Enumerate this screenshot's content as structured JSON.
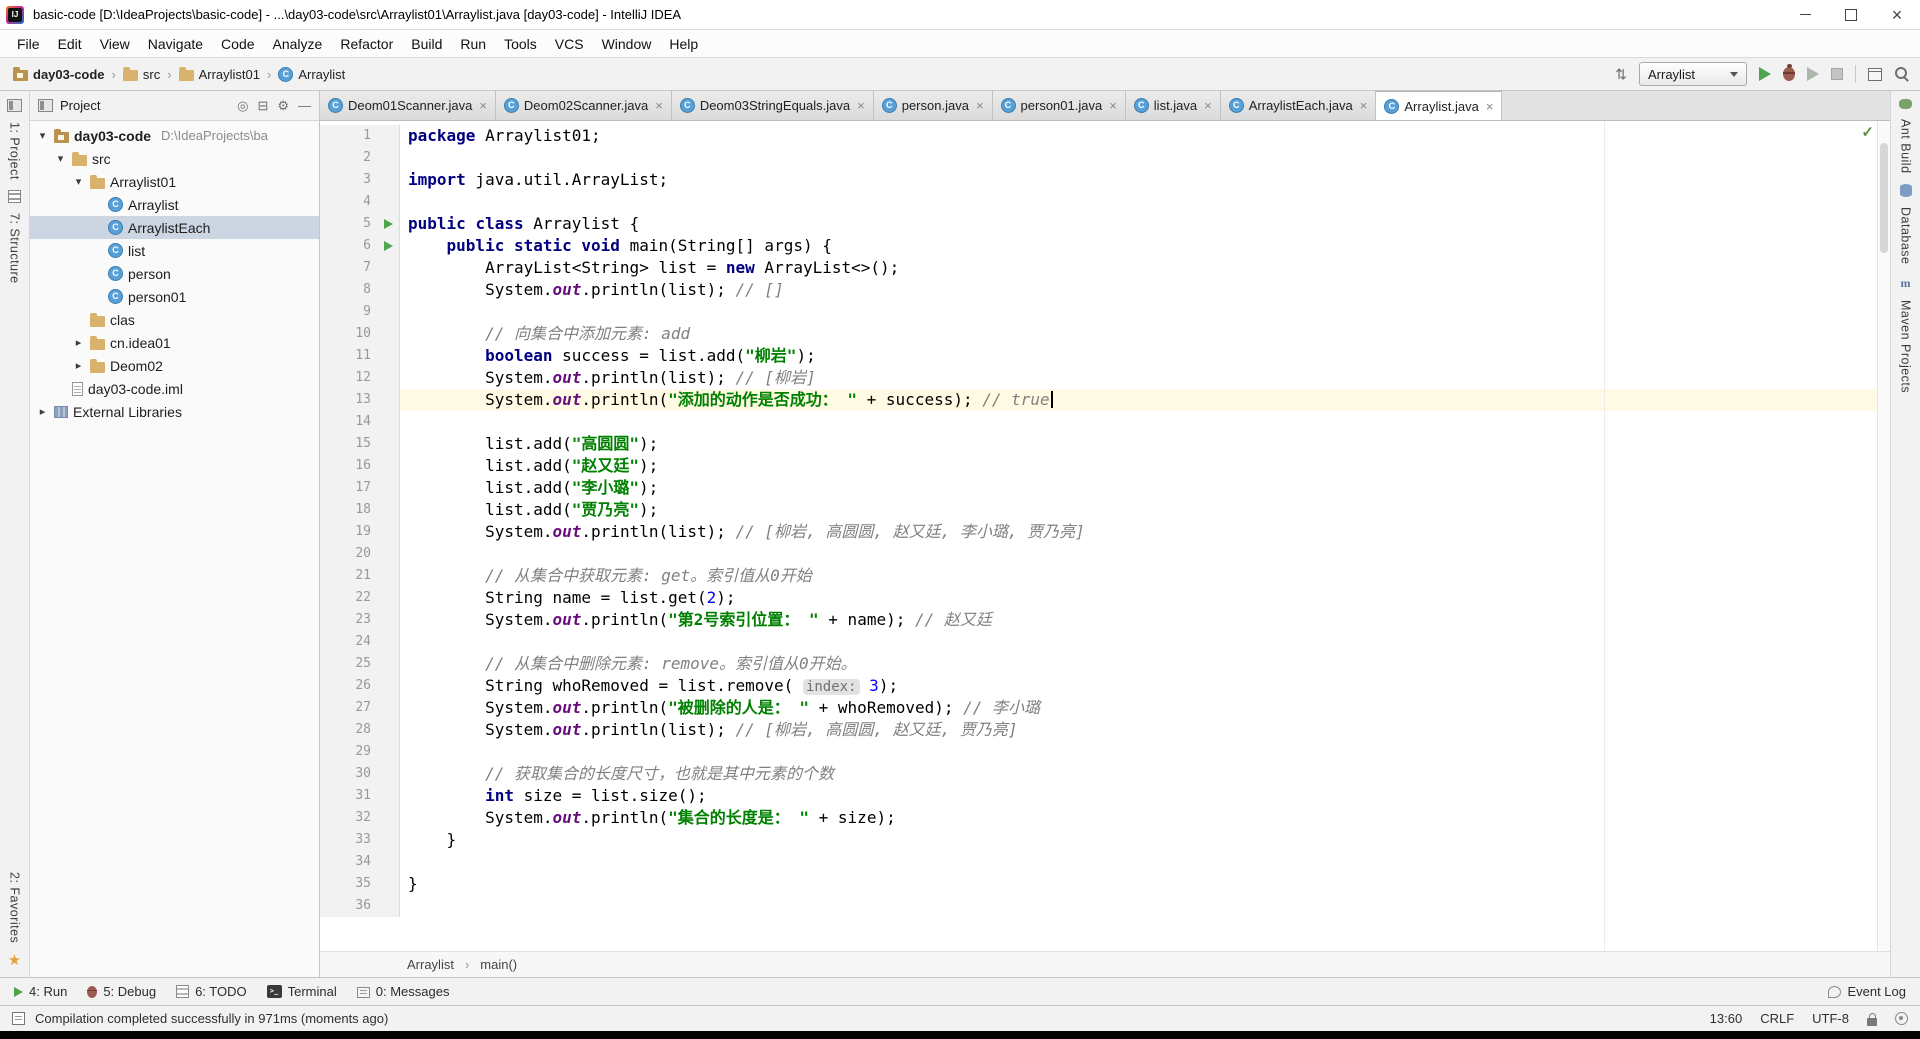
{
  "window": {
    "title": "basic-code [D:\\IdeaProjects\\basic-code] - ...\\day03-code\\src\\Arraylist01\\Arraylist.java [day03-code] - IntelliJ IDEA"
  },
  "menu": [
    "File",
    "Edit",
    "View",
    "Navigate",
    "Code",
    "Analyze",
    "Refactor",
    "Build",
    "Run",
    "Tools",
    "VCS",
    "Window",
    "Help"
  ],
  "navbar": {
    "crumbs": [
      {
        "label": "day03-code",
        "icon": "project"
      },
      {
        "label": "src",
        "icon": "folder"
      },
      {
        "label": "Arraylist01",
        "icon": "folder"
      },
      {
        "label": "Arraylist",
        "icon": "class"
      }
    ],
    "pre_icons": [
      "updates"
    ],
    "run_config": "Arraylist",
    "post_icons": [
      "run",
      "debug",
      "coverage",
      "stop",
      "sep",
      "project-structure",
      "search-everywhere"
    ]
  },
  "left_stripe": {
    "top": [
      {
        "icon": "tool-project",
        "label": "1: Project"
      },
      {
        "icon": "tool-structure",
        "label": "7: Structure"
      }
    ],
    "bottom": [
      {
        "label": "2: Favorites",
        "icon": "favorites-star",
        "icon_after": true
      }
    ]
  },
  "right_stripe": [
    {
      "icon": "tool-ant",
      "label": "Ant Build"
    },
    {
      "icon": "tool-db",
      "label": "Database"
    },
    {
      "icon": "tool-maven",
      "label": "Maven Projects"
    }
  ],
  "project_panel": {
    "title": "Project",
    "header_icons": [
      "locate",
      "collapse-all",
      "settings-gear",
      "hide-panel"
    ],
    "tree": [
      {
        "label": "day03-code",
        "hint": "D:\\IdeaProjects\\ba",
        "icon": "project",
        "depth": 0,
        "expand": "open",
        "bold": true
      },
      {
        "label": "src",
        "icon": "folder",
        "depth": 1,
        "expand": "open"
      },
      {
        "label": "Arraylist01",
        "icon": "folder",
        "depth": 2,
        "expand": "open"
      },
      {
        "label": "Arraylist",
        "icon": "class",
        "depth": 3
      },
      {
        "label": "ArraylistEach",
        "icon": "class",
        "depth": 3,
        "selected": true
      },
      {
        "label": "list",
        "icon": "class",
        "depth": 3
      },
      {
        "label": "person",
        "icon": "class",
        "depth": 3
      },
      {
        "label": "person01",
        "icon": "class",
        "depth": 3
      },
      {
        "label": "clas",
        "icon": "folder",
        "depth": 2
      },
      {
        "label": "cn.idea01",
        "icon": "folder",
        "depth": 2,
        "expand": "closed"
      },
      {
        "label": "Deom02",
        "icon": "folder",
        "depth": 2,
        "expand": "closed"
      },
      {
        "label": "day03-code.iml",
        "icon": "file",
        "depth": 1
      },
      {
        "label": "External Libraries",
        "icon": "lib",
        "depth": 0,
        "expand": "closed"
      }
    ]
  },
  "tabs": [
    {
      "label": "Deom01Scanner.java"
    },
    {
      "label": "Deom02Scanner.java"
    },
    {
      "label": "Deom03StringEquals.java"
    },
    {
      "label": "person.java"
    },
    {
      "label": "person01.java"
    },
    {
      "label": "list.java"
    },
    {
      "label": "ArraylistEach.java"
    },
    {
      "label": "Arraylist.java",
      "active": true
    }
  ],
  "editor": {
    "current_line": 13,
    "breadcrumb": [
      "Arraylist",
      "main()"
    ],
    "lines": [
      {
        "n": 1,
        "t": [
          [
            "k",
            "package"
          ],
          [
            "p",
            " Arraylist01;"
          ]
        ]
      },
      {
        "n": 2,
        "t": []
      },
      {
        "n": 3,
        "t": [
          [
            "k",
            "import"
          ],
          [
            "p",
            " java.util.ArrayList;"
          ]
        ]
      },
      {
        "n": 4,
        "t": []
      },
      {
        "n": 5,
        "run": true,
        "t": [
          [
            "k",
            "public"
          ],
          [
            "p",
            " "
          ],
          [
            "k",
            "class"
          ],
          [
            "p",
            " Arraylist {"
          ]
        ]
      },
      {
        "n": 6,
        "run": true,
        "t": [
          [
            "p",
            "    "
          ],
          [
            "k",
            "public"
          ],
          [
            "p",
            " "
          ],
          [
            "k",
            "static"
          ],
          [
            "p",
            " "
          ],
          [
            "k",
            "void"
          ],
          [
            "p",
            " main(String[] args) {"
          ]
        ]
      },
      {
        "n": 7,
        "t": [
          [
            "p",
            "        ArrayList<String> list = "
          ],
          [
            "k",
            "new"
          ],
          [
            "p",
            " ArrayList<>();"
          ]
        ]
      },
      {
        "n": 8,
        "t": [
          [
            "p",
            "        System."
          ],
          [
            "f",
            "out"
          ],
          [
            "p",
            ".println(list); "
          ],
          [
            "c",
            "// []"
          ]
        ]
      },
      {
        "n": 9,
        "t": []
      },
      {
        "n": 10,
        "t": [
          [
            "p",
            "        "
          ],
          [
            "c",
            "// 向集合中添加元素: add"
          ]
        ]
      },
      {
        "n": 11,
        "t": [
          [
            "p",
            "        "
          ],
          [
            "k",
            "boolean"
          ],
          [
            "p",
            " success = list.add("
          ],
          [
            "s",
            "\"柳岩\""
          ],
          [
            "p",
            ");"
          ]
        ]
      },
      {
        "n": 12,
        "t": [
          [
            "p",
            "        System."
          ],
          [
            "f",
            "out"
          ],
          [
            "p",
            ".println(list); "
          ],
          [
            "c",
            "// [柳岩]"
          ]
        ]
      },
      {
        "n": 13,
        "caret": true,
        "t": [
          [
            "p",
            "        System."
          ],
          [
            "f",
            "out"
          ],
          [
            "p",
            ".println("
          ],
          [
            "s",
            "\"添加的动作是否成功： \""
          ],
          [
            "p",
            " + success); "
          ],
          [
            "c",
            "// true"
          ]
        ]
      },
      {
        "n": 14,
        "t": []
      },
      {
        "n": 15,
        "t": [
          [
            "p",
            "        list.add("
          ],
          [
            "s",
            "\"高圆圆\""
          ],
          [
            "p",
            ");"
          ]
        ]
      },
      {
        "n": 16,
        "t": [
          [
            "p",
            "        list.add("
          ],
          [
            "s",
            "\"赵又廷\""
          ],
          [
            "p",
            ");"
          ]
        ]
      },
      {
        "n": 17,
        "t": [
          [
            "p",
            "        list.add("
          ],
          [
            "s",
            "\"李小璐\""
          ],
          [
            "p",
            ");"
          ]
        ]
      },
      {
        "n": 18,
        "t": [
          [
            "p",
            "        list.add("
          ],
          [
            "s",
            "\"贾乃亮\""
          ],
          [
            "p",
            ");"
          ]
        ]
      },
      {
        "n": 19,
        "t": [
          [
            "p",
            "        System."
          ],
          [
            "f",
            "out"
          ],
          [
            "p",
            ".println(list); "
          ],
          [
            "c",
            "// [柳岩, 高圆圆, 赵又廷, 李小璐, 贾乃亮]"
          ]
        ]
      },
      {
        "n": 20,
        "t": []
      },
      {
        "n": 21,
        "t": [
          [
            "p",
            "        "
          ],
          [
            "c",
            "// 从集合中获取元素: get。索引值从0开始"
          ]
        ]
      },
      {
        "n": 22,
        "t": [
          [
            "p",
            "        String name = list.get("
          ],
          [
            "num",
            "2"
          ],
          [
            "p",
            ");"
          ]
        ]
      },
      {
        "n": 23,
        "t": [
          [
            "p",
            "        System."
          ],
          [
            "f",
            "out"
          ],
          [
            "p",
            ".println("
          ],
          [
            "s",
            "\"第2号索引位置： \""
          ],
          [
            "p",
            " + name); "
          ],
          [
            "c",
            "// 赵又廷"
          ]
        ]
      },
      {
        "n": 24,
        "t": []
      },
      {
        "n": 25,
        "t": [
          [
            "p",
            "        "
          ],
          [
            "c",
            "// 从集合中删除元素: remove。索引值从0开始。"
          ]
        ]
      },
      {
        "n": 26,
        "t": [
          [
            "p",
            "        String whoRemoved = list.remove( "
          ],
          [
            "h",
            "index:"
          ],
          [
            "p",
            " "
          ],
          [
            "num",
            "3"
          ],
          [
            "p",
            ");"
          ]
        ]
      },
      {
        "n": 27,
        "t": [
          [
            "p",
            "        System."
          ],
          [
            "f",
            "out"
          ],
          [
            "p",
            ".println("
          ],
          [
            "s",
            "\"被删除的人是： \""
          ],
          [
            "p",
            " + whoRemoved); "
          ],
          [
            "c",
            "// 李小璐"
          ]
        ]
      },
      {
        "n": 28,
        "t": [
          [
            "p",
            "        System."
          ],
          [
            "f",
            "out"
          ],
          [
            "p",
            ".println(list); "
          ],
          [
            "c",
            "// [柳岩, 高圆圆, 赵又廷, 贾乃亮]"
          ]
        ]
      },
      {
        "n": 29,
        "t": []
      },
      {
        "n": 30,
        "t": [
          [
            "p",
            "        "
          ],
          [
            "c",
            "// 获取集合的长度尺寸，也就是其中元素的个数"
          ]
        ]
      },
      {
        "n": 31,
        "t": [
          [
            "p",
            "        "
          ],
          [
            "k",
            "int"
          ],
          [
            "p",
            " size = list.size();"
          ]
        ]
      },
      {
        "n": 32,
        "t": [
          [
            "p",
            "        System."
          ],
          [
            "f",
            "out"
          ],
          [
            "p",
            ".println("
          ],
          [
            "s",
            "\"集合的长度是： \""
          ],
          [
            "p",
            " + size);"
          ]
        ]
      },
      {
        "n": 33,
        "t": [
          [
            "p",
            "    }"
          ]
        ]
      },
      {
        "n": 34,
        "t": []
      },
      {
        "n": 35,
        "t": [
          [
            "p",
            "}"
          ]
        ]
      },
      {
        "n": 36,
        "t": []
      }
    ]
  },
  "bottom_bar": {
    "left": [
      {
        "label": "4: Run",
        "icon": "run-small"
      },
      {
        "label": "5: Debug",
        "icon": "debug-small"
      },
      {
        "label": "6: TODO",
        "icon": "todo"
      },
      {
        "label": "Terminal",
        "icon": "terminal"
      },
      {
        "label": "0: Messages",
        "icon": "messages"
      }
    ],
    "right": [
      {
        "label": "Event Log",
        "icon": "event-log"
      }
    ]
  },
  "status_bar": {
    "message": "Compilation completed successfully in 971ms (moments ago)",
    "position": "13:60",
    "line_separator": "CRLF",
    "encoding": "UTF-8"
  }
}
